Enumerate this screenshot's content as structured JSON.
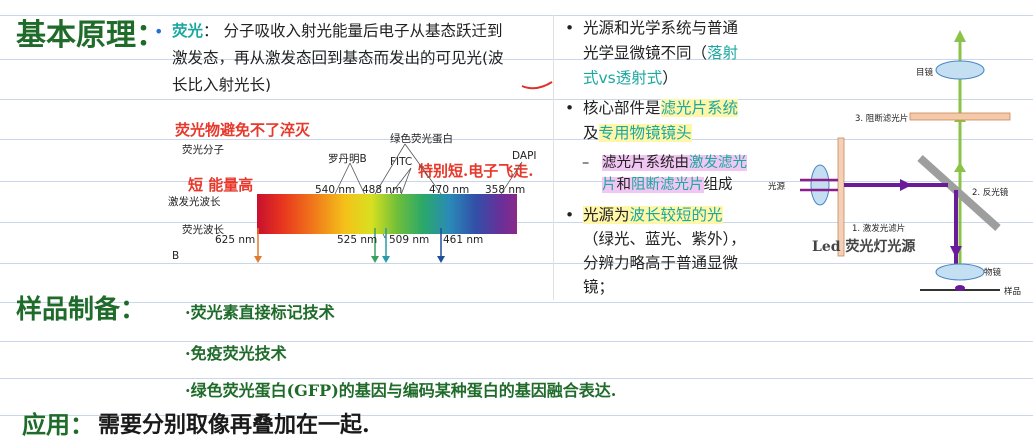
{
  "headings": {
    "principle": "基本原理：",
    "sample_prep": "样品制备：",
    "application_label": "应用：",
    "application_text": "需要分别取像再叠加在一起."
  },
  "fluorescence": {
    "term": "荧光",
    "colon": "：",
    "line1": "分子吸收入射光能量后电子从基态跃迁到",
    "line2": "激发态，再从激发态回到基态而发出的可见光(波",
    "line3": "长比入射光长)"
  },
  "handnotes": {
    "avoid_strong_light": "荧光物避免不了淬灭",
    "short_high_energy": "短 能量高",
    "short_wavelength": "特别短.电子飞走."
  },
  "spectrum": {
    "label_fluor_molecule": "荧光分子",
    "label_excitation": "激发光波长",
    "label_emission": "荧光波长",
    "label_B": "B",
    "label_gfp": "绿色荧光蛋白",
    "label_rhodamine": "罗丹明B",
    "label_fitc": "FITC",
    "label_dapi": "DAPI",
    "ex_values": [
      "540 nm",
      "488 nm",
      "470 nm",
      "358 nm"
    ],
    "em_values": [
      "625 nm",
      "525 nm",
      "509 nm",
      "461 nm"
    ],
    "em_colors": [
      "#e07a2c",
      "#3aa060",
      "#2a9aa8",
      "#1f4f9a"
    ]
  },
  "right_points": {
    "p1_line1": "光源和光学系统与普通",
    "p1_line2_a": "光学显微镜不同（",
    "p1_line2_b": "落射",
    "p1_line3": "式vs透射式",
    "p1_line3_end": "）",
    "p2_line1_a": "核心部件是",
    "p2_line1_b": "滤光片系统",
    "p2_line2_a": "及",
    "p2_line2_b": "专用物镜镜头",
    "sub_a": "滤光片系统由",
    "sub_b": "激发滤光",
    "sub_c": "片",
    "sub_d": "和",
    "sub_e": "阻断滤光片",
    "sub_f": "组成",
    "p3_line1_a": "光源为",
    "p3_line1_b": "波长较短的光",
    "p3_line2": "（绿光、蓝光、紫外），",
    "p3_line3": "分辨力略高于普通显微",
    "p3_line4": "镜；"
  },
  "microscope": {
    "eyepiece": "目镜",
    "barrier_filter": "3. 阻断滤光片",
    "dichroic": "2. 反光镜",
    "exciter_filter": "1. 激发光滤片",
    "light_source": "光源",
    "objective": "物镜",
    "specimen": "样品",
    "led_note": "Led 荧光灯光源"
  },
  "sample_items": [
    "·荧光素直接标记技术",
    "·免疫荧光技术",
    "·绿色荧光蛋白(GFP)的基因与编码某种蛋白的基因融合表达."
  ]
}
